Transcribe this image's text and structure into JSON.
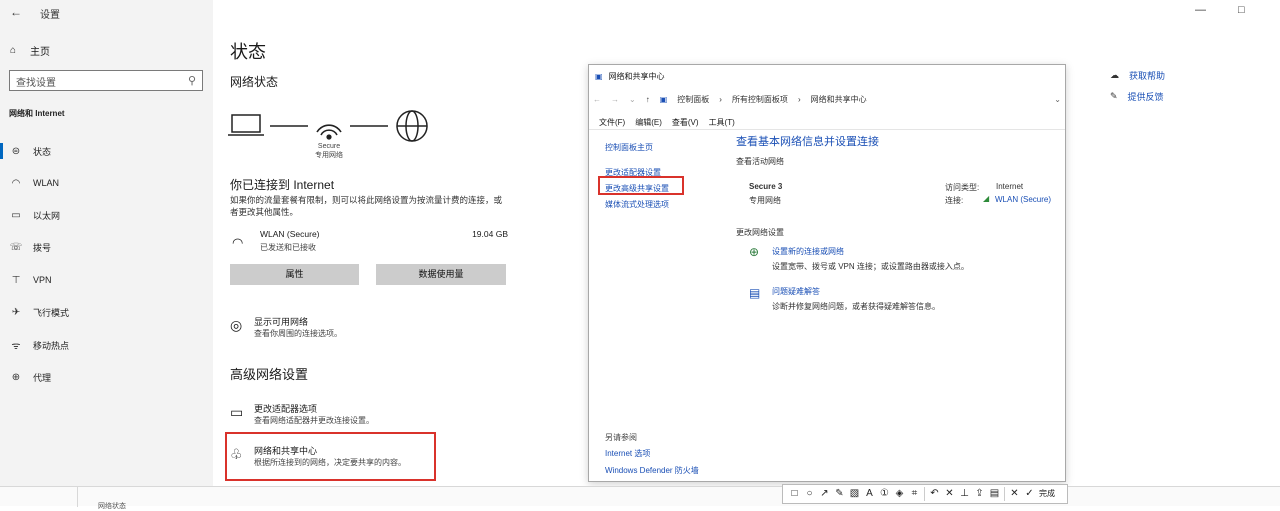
{
  "window": {
    "back": "←",
    "title": "设置",
    "minimize": "—",
    "maximize": "□"
  },
  "sidebar": {
    "home": "主页",
    "search_placeholder": "查找设置",
    "section": "网络和 Internet",
    "items": [
      {
        "label": "状态",
        "icon": "status-icon"
      },
      {
        "label": "WLAN",
        "icon": "wifi-icon"
      },
      {
        "label": "以太网",
        "icon": "ethernet-icon"
      },
      {
        "label": "拨号",
        "icon": "dialup-icon"
      },
      {
        "label": "VPN",
        "icon": "vpn-icon"
      },
      {
        "label": "飞行模式",
        "icon": "airplane-icon"
      },
      {
        "label": "移动热点",
        "icon": "hotspot-icon"
      },
      {
        "label": "代理",
        "icon": "globe-icon"
      }
    ]
  },
  "main": {
    "title": "状态",
    "network_status": "网络状态",
    "diagram_caption": [
      "Secure",
      "专用网络"
    ],
    "connected_heading": "你已连接到 Internet",
    "connected_desc": "如果你的流量套餐有限制，则可以将此网络设置为按流量计费的连接，或者更改其他属性。",
    "wlan_name": "WLAN (Secure)",
    "wlan_sub": "已发送和已接收",
    "wlan_stat": "19.04 GB",
    "btn_properties": "属性",
    "btn_data_usage": "数据使用量",
    "show_networks": "显示可用网络",
    "show_networks_desc": "查看你周围的连接选项。",
    "advanced_heading": "高级网络设置",
    "adapter_title": "更改适配器选项",
    "adapter_desc": "查看网络适配器并更改连接设置。",
    "sharing_center_title": "网络和共享中心",
    "sharing_center_desc": "根据所连接到的网络，决定要共享的内容。"
  },
  "control_panel": {
    "title": "网络和共享中心",
    "address": [
      "控制面板",
      "所有控制面板项",
      "网络和共享中心"
    ],
    "menu": [
      "文件(F)",
      "编辑(E)",
      "查看(V)",
      "工具(T)"
    ],
    "left_links": [
      "控制面板主页",
      "更改适配器设置",
      "更改高级共享设置",
      "媒体流式处理选项"
    ],
    "see_also": "另请参阅",
    "see_also_links": [
      "Internet 选项",
      "Windows Defender 防火墙"
    ],
    "heading": "查看基本网络信息并设置连接",
    "active_networks": "查看活动网络",
    "net_name": "Secure 3",
    "net_type": "专用网络",
    "access_type_label": "访问类型:",
    "access_type_value": "Internet",
    "connections_label": "连接:",
    "connections_value": "WLAN (Secure)",
    "change_settings": "更改网络设置",
    "new_connection_link": "设置新的连接或网络",
    "new_connection_desc": "设置宽带、拨号或 VPN 连接；或设置路由器或接入点。",
    "troubleshoot_link": "问题疑难解答",
    "troubleshoot_desc": "诊断并修复网络问题，或者获得疑难解答信息。"
  },
  "help": {
    "get_help": "获取帮助",
    "feedback": "提供反馈"
  },
  "bottom": {
    "text": "网络状态"
  },
  "toolbar": {
    "done": "完成"
  }
}
